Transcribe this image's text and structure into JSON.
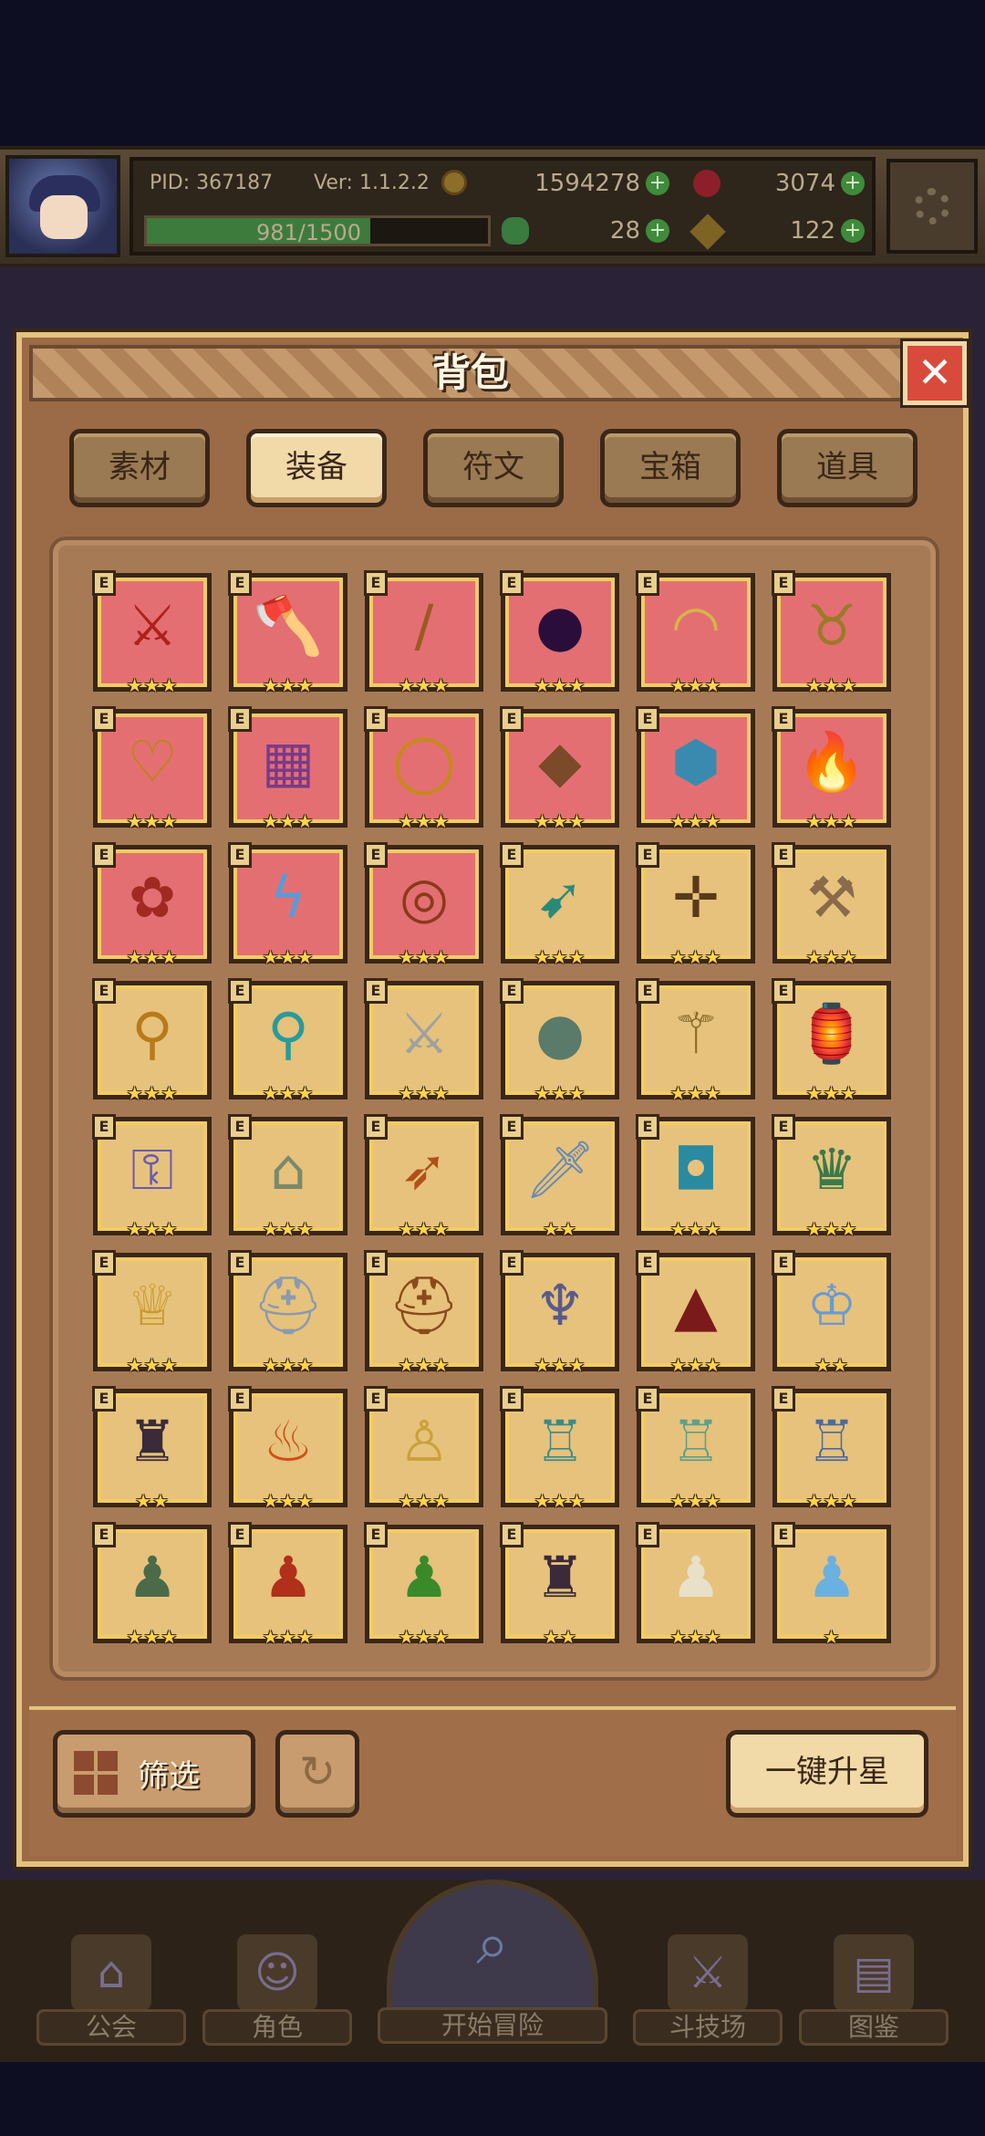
{
  "hud": {
    "pid": "PID: 367187",
    "version": "Ver: 1.1.2.2",
    "gold": "1594278",
    "gems": "3074",
    "energy": "981/1500",
    "energy_fraction": 0.654,
    "clover": "28",
    "keys": "122"
  },
  "panel": {
    "title": "背包",
    "close": "✕",
    "tabs": [
      "素材",
      "装备",
      "符文",
      "宝箱",
      "道具"
    ],
    "active_tab": 1
  },
  "items": [
    {
      "bg": "red",
      "icon": "crossed-axes-icon",
      "glyph": "⚔",
      "color": "#b0201a",
      "stars": "★★★"
    },
    {
      "bg": "red",
      "icon": "battle-axe-icon",
      "glyph": "🪓",
      "color": "#8b3a1d",
      "stars": "★★★"
    },
    {
      "bg": "red",
      "icon": "staff-icon",
      "glyph": "/",
      "color": "#9a5a22",
      "stars": "★★★"
    },
    {
      "bg": "red",
      "icon": "dark-orb-icon",
      "glyph": "●",
      "color": "#2a0d3a",
      "stars": "★★★"
    },
    {
      "bg": "red",
      "icon": "straw-hat-icon",
      "glyph": "◠",
      "color": "#d8b447",
      "stars": "★★★"
    },
    {
      "bg": "red",
      "icon": "horned-helmet-icon",
      "glyph": "♉",
      "color": "#9a7a28",
      "stars": "★★★"
    },
    {
      "bg": "red",
      "icon": "gold-necklace-icon",
      "glyph": "♡",
      "color": "#b8860b",
      "stars": "★★★"
    },
    {
      "bg": "red",
      "icon": "purple-necklace-icon",
      "glyph": "▦",
      "color": "#7a3a8a",
      "stars": "★★★"
    },
    {
      "bg": "red",
      "icon": "gold-ring-icon",
      "glyph": "◯",
      "color": "#c58a1a",
      "stars": "★★★"
    },
    {
      "bg": "red",
      "icon": "crystal-amulet-icon",
      "glyph": "◆",
      "color": "#7a4a2a",
      "stars": "★★★"
    },
    {
      "bg": "red",
      "icon": "ice-gauntlet-icon",
      "glyph": "⬢",
      "color": "#3a8ab0",
      "stars": "★★★"
    },
    {
      "bg": "red",
      "icon": "fire-ring-icon",
      "glyph": "🔥",
      "color": "#d8501a",
      "stars": "★★★"
    },
    {
      "bg": "red",
      "icon": "flesh-armor-icon",
      "glyph": "✿",
      "color": "#a02a22",
      "stars": "★★★"
    },
    {
      "bg": "red",
      "icon": "lightning-amulet-icon",
      "glyph": "ϟ",
      "color": "#5a9ad8",
      "stars": "★★★"
    },
    {
      "bg": "red",
      "icon": "barrel-drum-icon",
      "glyph": "◎",
      "color": "#8a3a1a",
      "stars": "★★★"
    },
    {
      "bg": "gold",
      "icon": "jade-bow-icon",
      "glyph": "➹",
      "color": "#2a8a7a",
      "stars": "★★★"
    },
    {
      "bg": "gold",
      "icon": "crossbow-icon",
      "glyph": "✛",
      "color": "#5a3a1a",
      "stars": "★★★"
    },
    {
      "bg": "gold",
      "icon": "bone-hammer-icon",
      "glyph": "⚒",
      "color": "#8a6a4a",
      "stars": "★★★"
    },
    {
      "bg": "gold",
      "icon": "gold-mace-icon",
      "glyph": "⚲",
      "color": "#b87a1a",
      "stars": "★★★"
    },
    {
      "bg": "gold",
      "icon": "cyan-mace-icon",
      "glyph": "⚲",
      "color": "#2a9a9a",
      "stars": "★★★"
    },
    {
      "bg": "gold",
      "icon": "rapier-icon",
      "glyph": "⚔",
      "color": "#a0a0a0",
      "stars": "★★★"
    },
    {
      "bg": "gold",
      "icon": "stone-orb-icon",
      "glyph": "●",
      "color": "#5a7a6a",
      "stars": "★★★"
    },
    {
      "bg": "gold",
      "icon": "scepter-icon",
      "glyph": "⚚",
      "color": "#8a6a2a",
      "stars": "★★★"
    },
    {
      "bg": "gold",
      "icon": "lantern-icon",
      "glyph": "🏮",
      "color": "#c0501a",
      "stars": "★★★"
    },
    {
      "bg": "gold",
      "icon": "purple-key-icon",
      "glyph": "⚿",
      "color": "#6a5ab0",
      "stars": "★★★"
    },
    {
      "bg": "gold",
      "icon": "magic-lamp-icon",
      "glyph": "⌂",
      "color": "#7a8a6a",
      "stars": "★★★"
    },
    {
      "bg": "gold",
      "icon": "spear-icon",
      "glyph": "➶",
      "color": "#b0501a",
      "stars": "★★★"
    },
    {
      "bg": "gold",
      "icon": "short-sword-icon",
      "glyph": "🗡",
      "color": "#6a8ab0",
      "stars": "★★"
    },
    {
      "bg": "gold",
      "icon": "tech-goggles-icon",
      "glyph": "◘",
      "color": "#2a8aa0",
      "stars": "★★★"
    },
    {
      "bg": "gold",
      "icon": "jeweled-crown-icon",
      "glyph": "♛",
      "color": "#3a7a4a",
      "stars": "★★★"
    },
    {
      "bg": "gold",
      "icon": "gold-crown-icon",
      "glyph": "♕",
      "color": "#c89a2a",
      "stars": "★★★"
    },
    {
      "bg": "gold",
      "icon": "silver-helmet-icon",
      "glyph": "⛑",
      "color": "#8a9ab0",
      "stars": "★★★"
    },
    {
      "bg": "gold",
      "icon": "bronze-helmet-icon",
      "glyph": "⛑",
      "color": "#8a4a1a",
      "stars": "★★★"
    },
    {
      "bg": "gold",
      "icon": "winged-helmet-icon",
      "glyph": "♆",
      "color": "#5a5a8a",
      "stars": "★★★"
    },
    {
      "bg": "gold",
      "icon": "red-hood-icon",
      "glyph": "▲",
      "color": "#7a1a1a",
      "stars": "★★★"
    },
    {
      "bg": "gold",
      "icon": "crystal-crown-icon",
      "glyph": "♔",
      "color": "#6a9ad0",
      "stars": "★★"
    },
    {
      "bg": "gold",
      "icon": "demon-helmet-icon",
      "glyph": "♜",
      "color": "#3a2a3a",
      "stars": "★★"
    },
    {
      "bg": "gold",
      "icon": "flame-cape-icon",
      "glyph": "♨",
      "color": "#d0501a",
      "stars": "★★★"
    },
    {
      "bg": "gold",
      "icon": "gold-robe-icon",
      "glyph": "♙",
      "color": "#c8a23a",
      "stars": "★★★"
    },
    {
      "bg": "gold",
      "icon": "teal-armor-icon",
      "glyph": "♖",
      "color": "#3a8a8a",
      "stars": "★★★"
    },
    {
      "bg": "gold",
      "icon": "leaf-armor-icon",
      "glyph": "♖",
      "color": "#5aa08a",
      "stars": "★★★"
    },
    {
      "bg": "gold",
      "icon": "blue-plate-icon",
      "glyph": "♖",
      "color": "#4a6aa0",
      "stars": "★★★"
    },
    {
      "bg": "gold",
      "icon": "green-cloak-icon",
      "glyph": "♟",
      "color": "#4a6a4a",
      "stars": "★★★"
    },
    {
      "bg": "gold",
      "icon": "red-robe-icon",
      "glyph": "♟",
      "color": "#b0301a",
      "stars": "★★★"
    },
    {
      "bg": "gold",
      "icon": "green-robe-icon",
      "glyph": "♟",
      "color": "#3a8a2a",
      "stars": "★★★"
    },
    {
      "bg": "gold",
      "icon": "dark-armor-icon",
      "glyph": "♜",
      "color": "#3a2a3a",
      "stars": "★★"
    },
    {
      "bg": "gold",
      "icon": "white-robe-icon",
      "glyph": "♟",
      "color": "#e8e0c8",
      "stars": "★★★"
    },
    {
      "bg": "gold",
      "icon": "ice-armor-icon",
      "glyph": "♟",
      "color": "#6ab0e0",
      "stars": "★"
    }
  ],
  "bottom": {
    "filter": "筛选",
    "refresh": "↻",
    "upgrade_all": "一键升星"
  },
  "nav": {
    "guild": "公会",
    "character": "角色",
    "adventure": "开始冒险",
    "arena": "斗技场",
    "codex": "图鉴"
  }
}
